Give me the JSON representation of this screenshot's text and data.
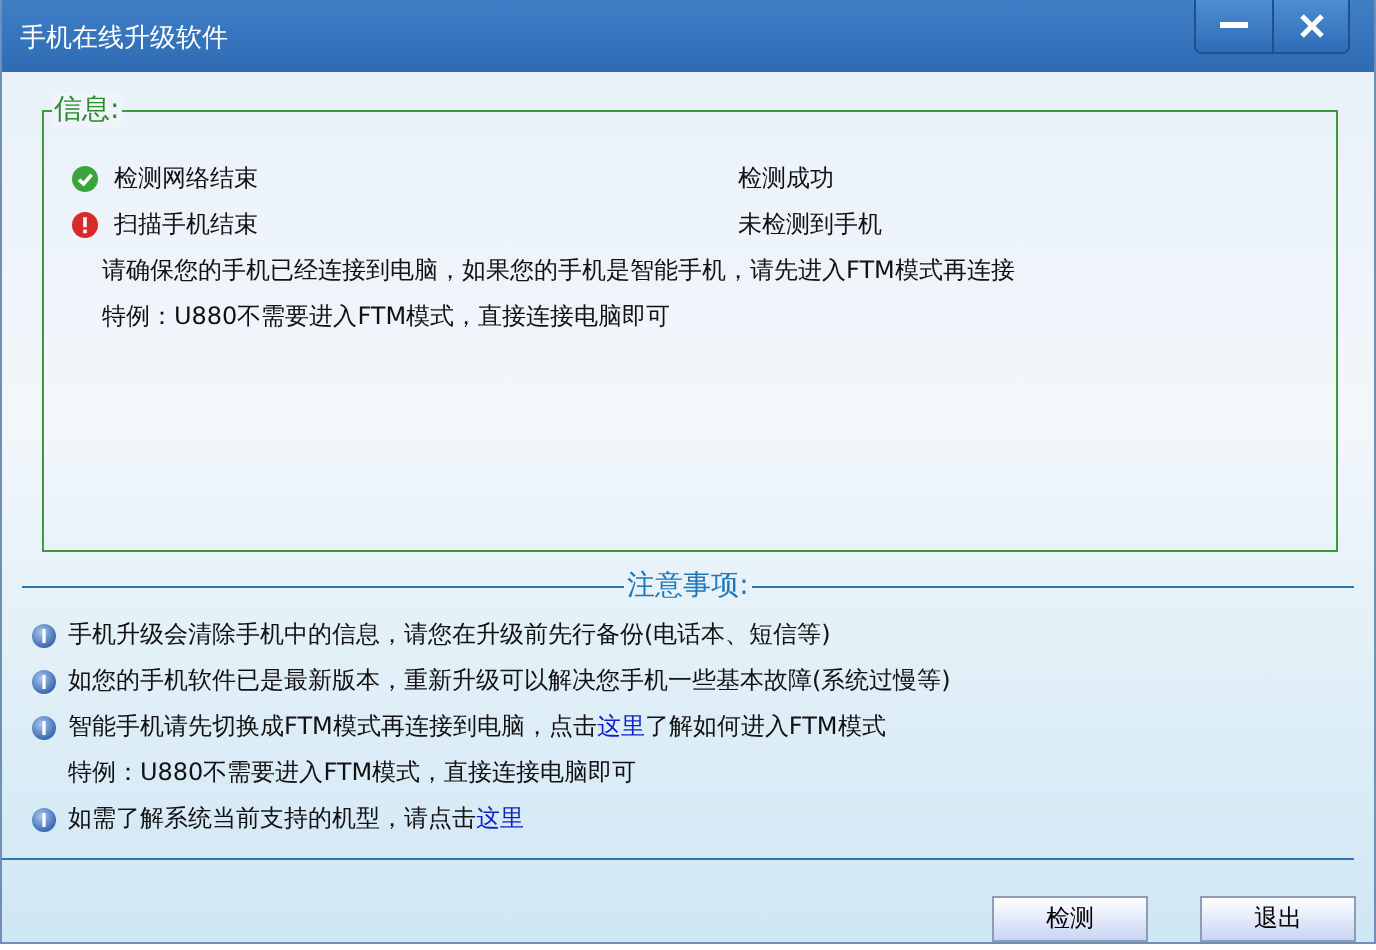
{
  "window": {
    "title": "手机在线升级软件"
  },
  "info": {
    "legend": "信息:",
    "rows": [
      {
        "kind": "status",
        "ok": true,
        "label": "检测网络结束",
        "result": "检测成功"
      },
      {
        "kind": "status",
        "ok": false,
        "label": "扫描手机结束",
        "result": "未检测到手机"
      },
      {
        "kind": "text",
        "text": "请确保您的手机已经连接到电脑，如果您的手机是智能手机，请先进入FTM模式再连接"
      },
      {
        "kind": "text",
        "text": "特例：U880不需要进入FTM模式，直接连接电脑即可"
      }
    ]
  },
  "notes": {
    "title": "注意事项:",
    "items": [
      {
        "kind": "bullet",
        "text": "手机升级会清除手机中的信息，请您在升级前先行备份(电话本、短信等)"
      },
      {
        "kind": "bullet",
        "text": "如您的手机软件已是最新版本，重新升级可以解决您手机一些基本故障(系统过慢等)"
      },
      {
        "kind": "bullet",
        "text": "智能手机请先切换成FTM模式再连接到电脑，点击",
        "link": "这里",
        "after": "了解如何进入FTM模式"
      },
      {
        "kind": "plain",
        "text": "特例：U880不需要进入FTM模式，直接连接电脑即可"
      },
      {
        "kind": "bullet",
        "text": "如需了解系统当前支持的机型，请点击",
        "link": "这里"
      }
    ]
  },
  "buttons": [
    "检测",
    "退出"
  ]
}
